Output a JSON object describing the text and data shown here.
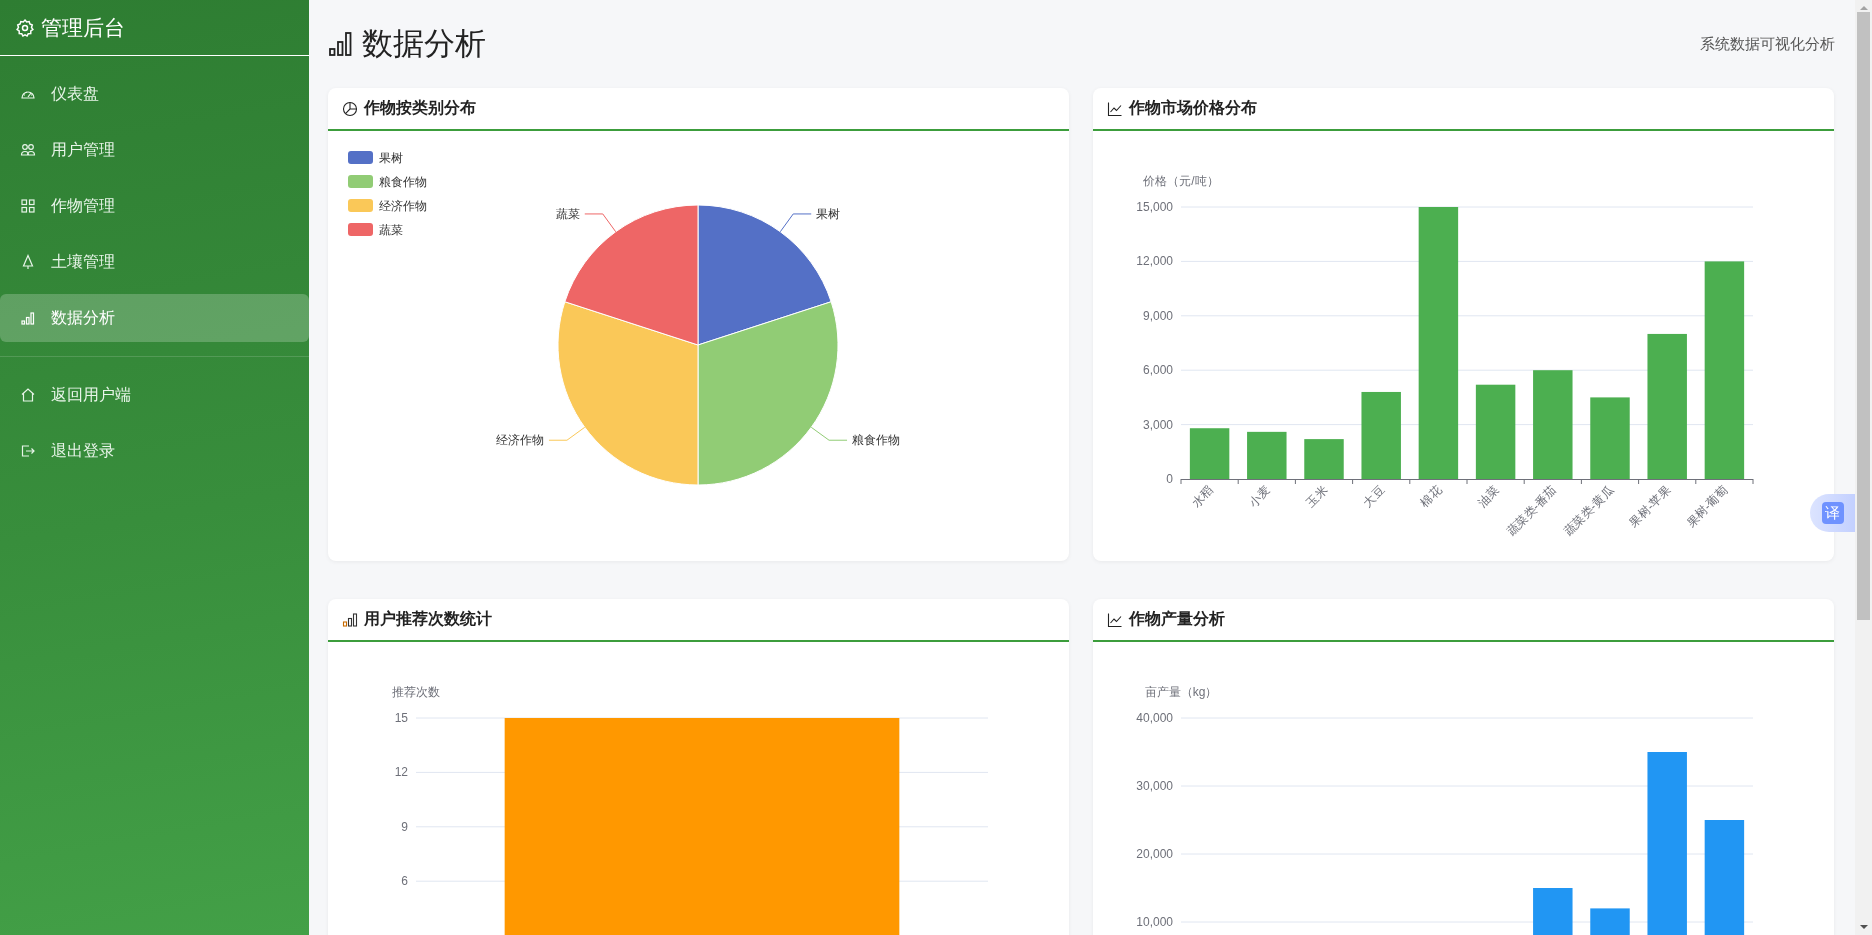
{
  "sidebar": {
    "title": "管理后台",
    "items": [
      {
        "label": "仪表盘",
        "selected": false
      },
      {
        "label": "用户管理",
        "selected": false
      },
      {
        "label": "作物管理",
        "selected": false
      },
      {
        "label": "土壤管理",
        "selected": false
      },
      {
        "label": "数据分析",
        "selected": true
      }
    ],
    "footer_items": [
      {
        "label": "返回用户端"
      },
      {
        "label": "退出登录"
      }
    ]
  },
  "header": {
    "title": "数据分析",
    "subtitle": "系统数据可视化分析"
  },
  "cards": [
    {
      "title": "作物按类别分布",
      "chart_data": {
        "type": "pie",
        "categories": [
          "果树",
          "粮食作物",
          "经济作物",
          "蔬菜"
        ],
        "values": [
          20,
          30,
          30,
          20
        ],
        "legend": true,
        "colors": [
          "#5470c6",
          "#91cc75",
          "#fac858",
          "#ee6666"
        ]
      }
    },
    {
      "title": "作物市场价格分布",
      "chart_data": {
        "type": "bar",
        "ylabel": "价格（元/吨）",
        "grid": true,
        "categories": [
          "水稻",
          "小麦",
          "玉米",
          "大豆",
          "棉花",
          "油菜",
          "蔬菜类-番茄",
          "蔬菜类-黄瓜",
          "果树-苹果",
          "果树-葡萄"
        ],
        "ylim": [
          0,
          15000
        ],
        "yticks": [
          {
            "value": 0,
            "label": "0"
          },
          {
            "value": 3000,
            "label": "3,000"
          },
          {
            "value": 6000,
            "label": "6,000"
          },
          {
            "value": 9000,
            "label": "9,000"
          },
          {
            "value": 12000,
            "label": "12,000"
          },
          {
            "value": 15000,
            "label": "15,000"
          }
        ],
        "series": [
          {
            "color": "#4caf50",
            "values": [
              2800,
              2600,
              2200,
              4800,
              15000,
              5200,
              6000,
              4500,
              8000,
              12000
            ]
          }
        ]
      }
    },
    {
      "title": "用户推荐次数统计",
      "chart_data": {
        "type": "bar",
        "ylabel": "推荐次数",
        "grid": true,
        "ylim": [
          0,
          15
        ],
        "yticks": [
          {
            "value": 6,
            "label": "6"
          },
          {
            "value": 9,
            "label": "9"
          },
          {
            "value": 12,
            "label": "12"
          },
          {
            "value": 15,
            "label": "15"
          }
        ],
        "series": [
          {
            "color": "#ff9800",
            "values": [
              15
            ]
          }
        ]
      }
    },
    {
      "title": "作物产量分析",
      "chart_data": {
        "type": "bar",
        "ylabel": "亩产量（kg）",
        "grid": true,
        "ylim": [
          0,
          40000
        ],
        "yticks": [
          {
            "value": 10000,
            "label": "10,000"
          },
          {
            "value": 20000,
            "label": "20,000"
          },
          {
            "value": 30000,
            "label": "30,000"
          },
          {
            "value": 40000,
            "label": "40,000"
          }
        ],
        "series": [
          {
            "color": "#2196f3",
            "values": [
              null,
              null,
              null,
              null,
              null,
              null,
              15000,
              12000,
              35000,
              25000
            ]
          }
        ]
      }
    }
  ],
  "translate_button": "译"
}
